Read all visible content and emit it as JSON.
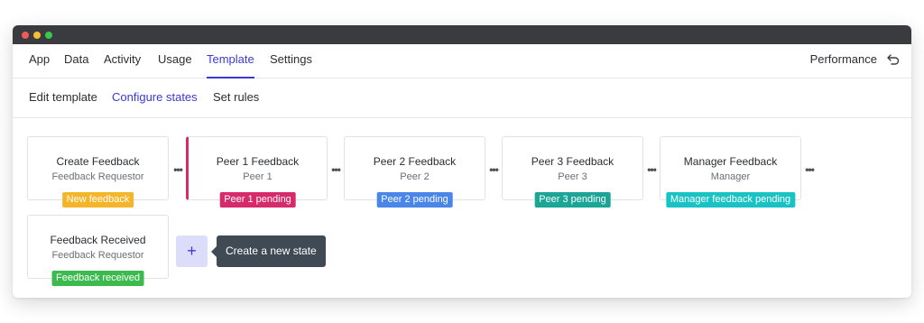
{
  "topnav": {
    "items": [
      {
        "label": "App"
      },
      {
        "label": "Data"
      },
      {
        "label": "Activity"
      },
      {
        "label": "Usage"
      },
      {
        "label": "Template",
        "active": true
      },
      {
        "label": "Settings"
      }
    ],
    "right_label": "Performance",
    "right_icon": "undo-arrow-icon"
  },
  "subnav": {
    "items": [
      {
        "label": "Edit template"
      },
      {
        "label": "Configure states",
        "active": true
      },
      {
        "label": "Set rules"
      }
    ]
  },
  "states": [
    {
      "title": "Create Feedback",
      "role": "Feedback Requestor",
      "badge": "New feedback",
      "badge_color": "#f5b52a"
    },
    {
      "title": "Peer 1 Feedback",
      "role": "Peer 1",
      "badge": "Peer 1 pending",
      "badge_color": "#d72a6a",
      "selected": true
    },
    {
      "title": "Peer 2 Feedback",
      "role": "Peer 2",
      "badge": "Peer 2 pending",
      "badge_color": "#4a86e8"
    },
    {
      "title": "Peer 3 Feedback",
      "role": "Peer 3",
      "badge": "Peer 3 pending",
      "badge_color": "#1aa596"
    },
    {
      "title": "Manager Feedback",
      "role": "Manager",
      "badge": "Manager feedback pending",
      "badge_color": "#19c3c3"
    },
    {
      "title": "Feedback Received",
      "role": "Feedback Requestor",
      "badge": "Feedback received",
      "badge_color": "#3dba4e"
    }
  ],
  "more_icon": "more-dots-icon",
  "add_button": {
    "label": "+",
    "icon": "plus-icon"
  },
  "tooltip": {
    "text": "Create a new state"
  },
  "colors": {
    "accent": "#3b39d6",
    "titlebar": "#3a3b3f",
    "tooltip_bg": "#3f4a55",
    "add_bg": "#dcdcfb"
  }
}
